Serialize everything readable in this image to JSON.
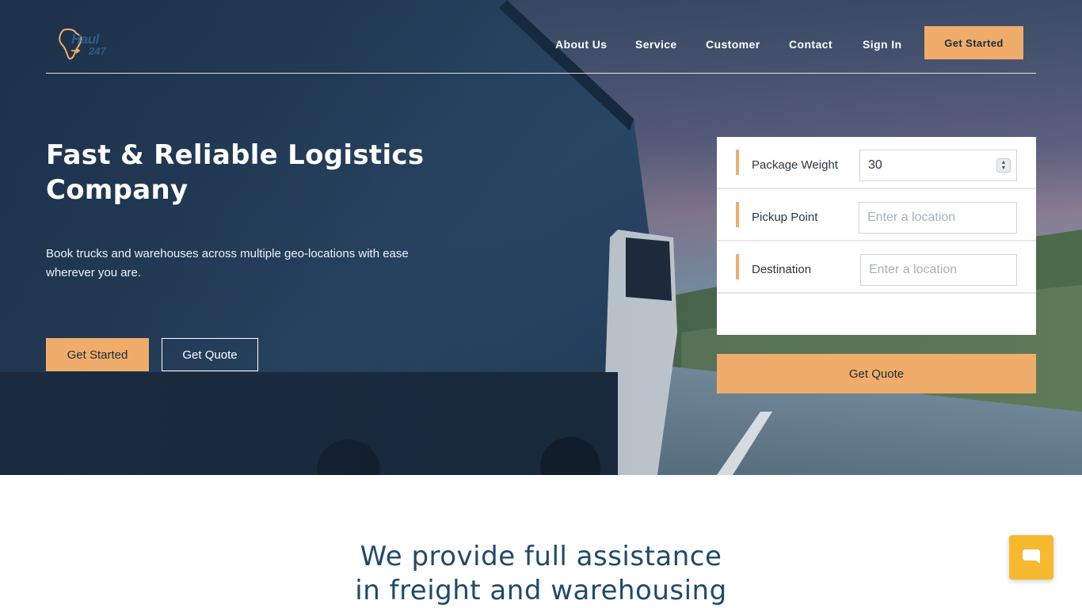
{
  "brand": {
    "logo_line1": "Haul",
    "logo_line2": "247",
    "accent_color": "#f0ac6b"
  },
  "nav": {
    "items": [
      {
        "label": "About Us"
      },
      {
        "label": "Service"
      },
      {
        "label": "Customer"
      },
      {
        "label": "Contact"
      },
      {
        "label": "Sign In"
      }
    ],
    "cta_label": "Get Started"
  },
  "hero": {
    "title": "Fast & Reliable Logistics Company",
    "subtitle": "Book trucks and warehouses across multiple geo-locations with ease wherever you are.",
    "primary_button": "Get Started",
    "secondary_button": "Get Quote"
  },
  "quote_form": {
    "weight_label": "Package Weight",
    "weight_value": "30",
    "pickup_label": "Pickup Point",
    "pickup_placeholder": "Enter a location",
    "destination_label": "Destination",
    "destination_placeholder": "Enter a location",
    "submit_label": "Get Quote"
  },
  "section": {
    "heading_line1": "We provide full assistance",
    "heading_line2": "in freight and warehousing"
  },
  "chat_widget": {
    "icon": "chat-bubble-icon",
    "color": "#f5b82e"
  }
}
